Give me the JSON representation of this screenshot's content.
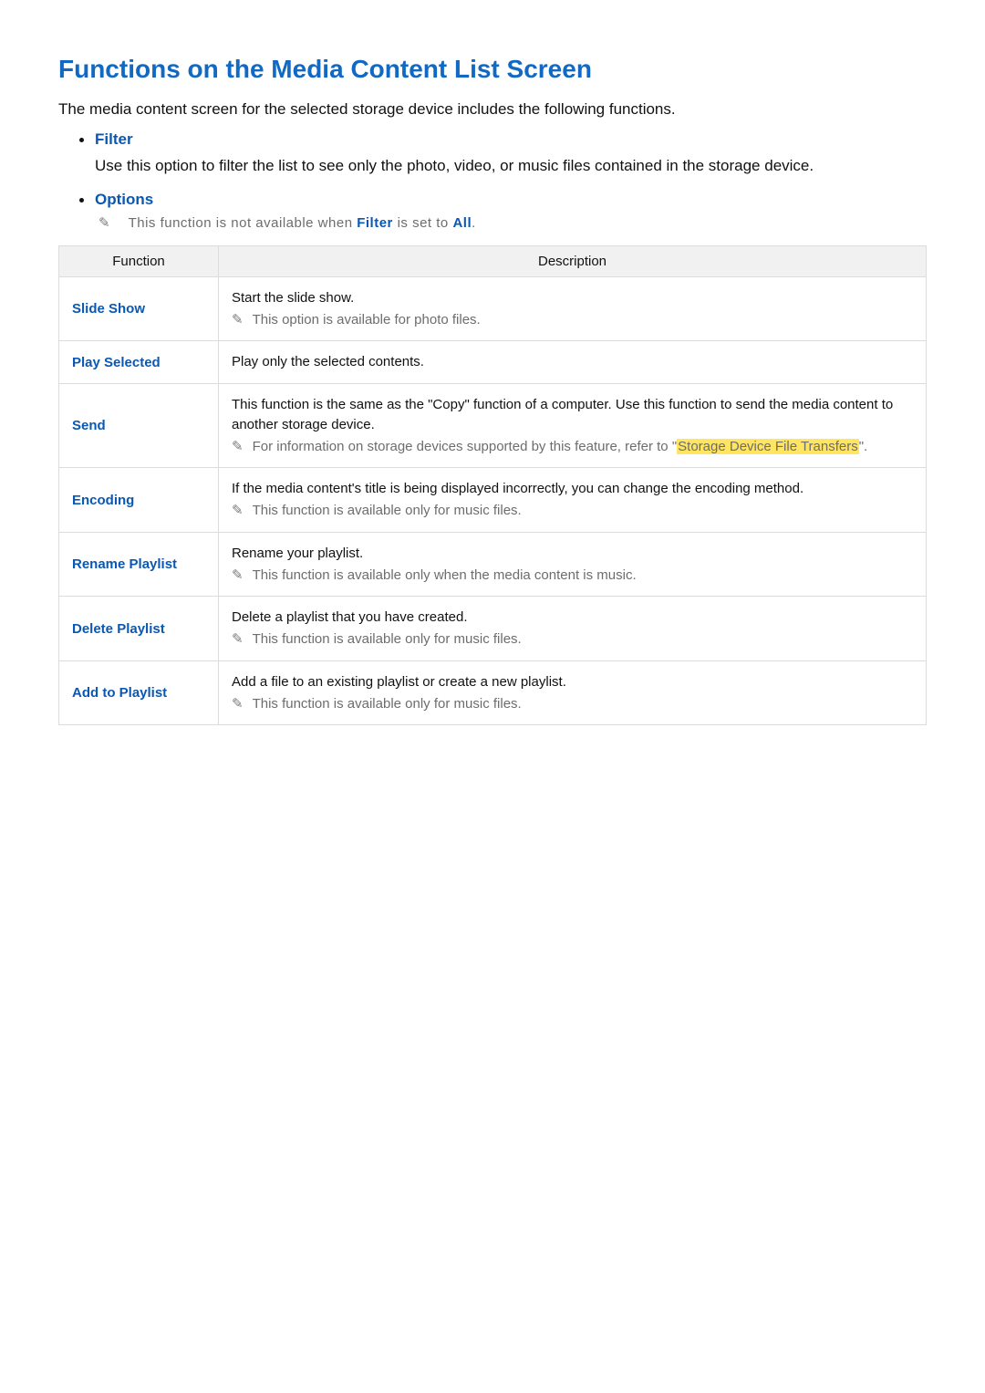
{
  "title": "Functions on the Media Content List Screen",
  "intro": "The media content screen for the selected storage device includes the following functions.",
  "bullets": [
    {
      "label": "Filter",
      "desc": "Use this option to filter the list to see only the photo, video, or music files contained in the storage device."
    },
    {
      "label": "Options",
      "note_pre": "This function is not available when ",
      "note_kw1": "Filter",
      "note_mid": " is set to ",
      "note_kw2": "All",
      "note_post": "."
    }
  ],
  "table": {
    "headers": {
      "function": "Function",
      "description": "Description"
    },
    "rows": [
      {
        "fn": "Slide Show",
        "main": "Start the slide show.",
        "note": "This option is available for photo files."
      },
      {
        "fn": "Play Selected",
        "main": "Play only the selected contents."
      },
      {
        "fn": "Send",
        "main": "This function is the same as the \"Copy\" function of a computer. Use this function to send the media content to another storage device.",
        "note_pre": "For information on storage devices supported by this feature, refer to \"",
        "note_hl": "Storage Device File Transfers",
        "note_post": "\"."
      },
      {
        "fn": "Encoding",
        "main": "If the media content's title is being displayed incorrectly, you can change the encoding method.",
        "note": "This function is available only for music files."
      },
      {
        "fn": "Rename Playlist",
        "main": "Rename your playlist.",
        "note": "This function is available only when the media content is music."
      },
      {
        "fn": "Delete Playlist",
        "main": "Delete a playlist that you have created.",
        "note": "This function is available only for music files."
      },
      {
        "fn": "Add to Playlist",
        "main": "Add a file to an existing playlist or create a new playlist.",
        "note": "This function is available only for music files."
      }
    ]
  }
}
